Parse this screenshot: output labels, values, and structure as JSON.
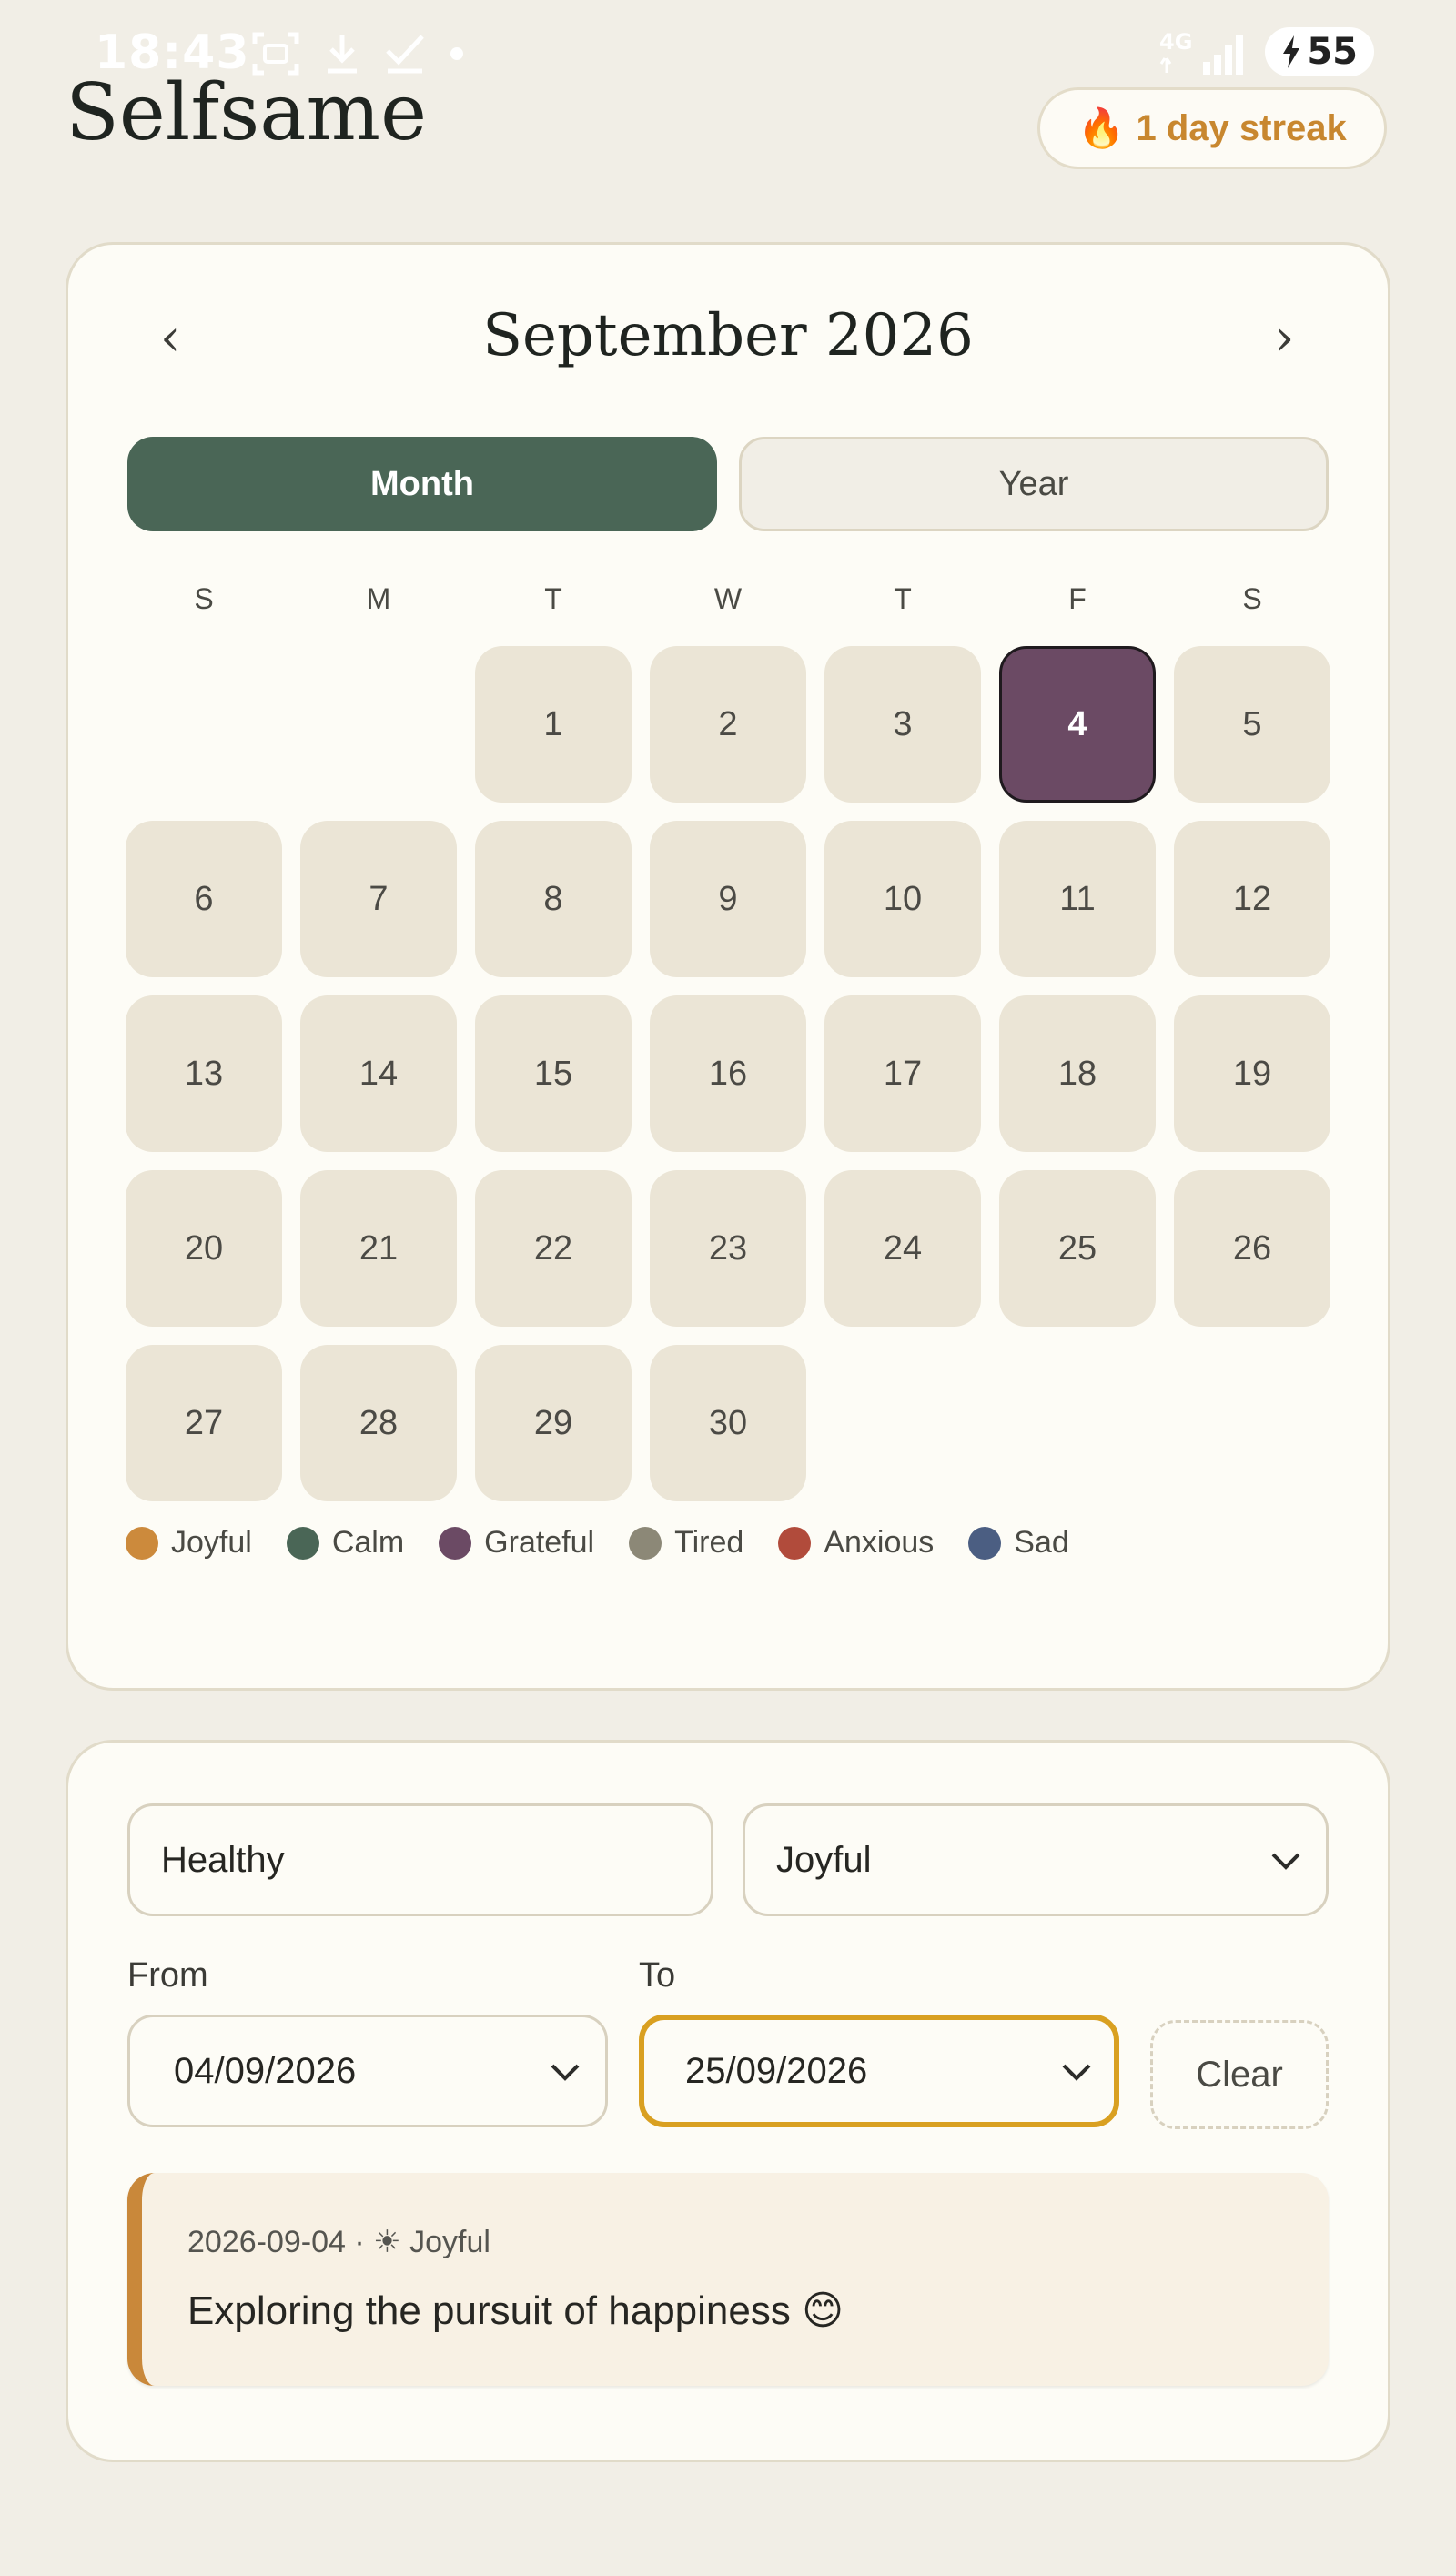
{
  "status_bar": {
    "time": "18:43",
    "network": "4G",
    "battery": "55",
    "icons": [
      "screenshot-icon",
      "download-icon",
      "check-icon",
      "dot-icon",
      "signal-icon",
      "charging-icon"
    ]
  },
  "header": {
    "title": "Selfsame",
    "streak_icon": "🔥",
    "streak_label": "1 day streak"
  },
  "calendar": {
    "month_title": "September 2026",
    "prev_arrow": "‹",
    "next_arrow": "›",
    "view_toggle": {
      "month": "Month",
      "year": "Year",
      "active": "Month"
    },
    "weekdays": [
      "S",
      "M",
      "T",
      "W",
      "T",
      "F",
      "S"
    ],
    "days": [
      "1",
      "2",
      "3",
      "4",
      "5",
      "6",
      "7",
      "8",
      "9",
      "10",
      "11",
      "12",
      "13",
      "14",
      "15",
      "16",
      "17",
      "18",
      "19",
      "20",
      "21",
      "22",
      "23",
      "24",
      "25",
      "26",
      "27",
      "28",
      "29",
      "30"
    ],
    "selected_day": "4",
    "legend": [
      {
        "label": "Joyful",
        "color": "#cc8a3c"
      },
      {
        "label": "Calm",
        "color": "#4a6656"
      },
      {
        "label": "Grateful",
        "color": "#6b4a64"
      },
      {
        "label": "Tired",
        "color": "#8c8877"
      },
      {
        "label": "Anxious",
        "color": "#b14b3b"
      },
      {
        "label": "Sad",
        "color": "#4b5e82"
      }
    ]
  },
  "filters": {
    "search_value": "Healthy",
    "mood_value": "Joyful",
    "from_label": "From",
    "from_value": "04/09/2026",
    "to_label": "To",
    "to_value": "25/09/2026",
    "clear_label": "Clear"
  },
  "entries": [
    {
      "date": "2026-09-04",
      "separator": "·",
      "mood_icon": "☀",
      "mood": "Joyful",
      "text": "Exploring the pursuit of happiness 😊",
      "accent": "#c9883a"
    }
  ]
}
